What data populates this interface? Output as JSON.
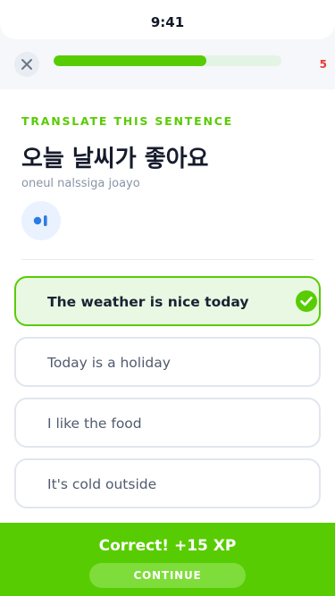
{
  "status_bar": {
    "time": "9:41"
  },
  "header": {
    "close_icon": "close-icon",
    "progress": 0.67,
    "hearts_count": "5",
    "colors": {
      "progress_fill": "#58cc02",
      "progress_track": "#e3f4e4",
      "hearts": "#e53935"
    }
  },
  "lesson": {
    "instruction": "TRANSLATE THIS SENTENCE",
    "sentence": "오늘 날씨가 좋아요",
    "romanization": "oneul nalssiga joayo",
    "audio_icon": "speaker-icon"
  },
  "options": [
    {
      "label": "The weather is nice today",
      "state": "correct"
    },
    {
      "label": "Today is a holiday",
      "state": "default"
    },
    {
      "label": "I like the food",
      "state": "default"
    },
    {
      "label": "It's cold outside",
      "state": "default"
    }
  ],
  "footer": {
    "feedback": "Correct! +15 XP",
    "continue_label": "CONTINUE",
    "colors": {
      "background": "#58cc02",
      "button": "#7edd3a"
    }
  }
}
